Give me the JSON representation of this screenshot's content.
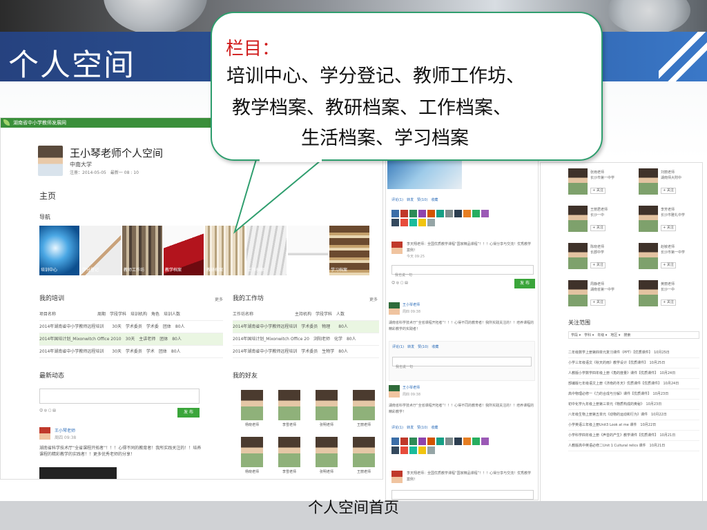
{
  "slide": {
    "title": "个人空间",
    "caption": "个人空间首页"
  },
  "callout": {
    "heading": "栏目：",
    "line1": "培训中心、学分登记、教师工作坊、",
    "line2": "教学档案、教研档案、工作档案、",
    "line3": "生活档案、学习档案"
  },
  "screenshot_left": {
    "site_name": "湖南省中小学教师发展网",
    "profile": {
      "name": "王小琴老师个人空间",
      "org": "中南大学",
      "dates": "注册：2014-05-05　最新一 08 : 10"
    },
    "home_title": "主页",
    "nav_title": "导航",
    "nav_tiles": [
      {
        "label": "培训中心"
      },
      {
        "label": "学分登记"
      },
      {
        "label": "教师工作坊"
      },
      {
        "label": "教学档案"
      },
      {
        "label": "教研档案"
      },
      {
        "label": "工作档案"
      },
      {
        "label": "生活档案"
      },
      {
        "label": "学习档案"
      }
    ],
    "training": {
      "title": "我的培训",
      "more": "更多",
      "rows": [
        "项目名称　　　　　　　　　　周期　学段学科　培训机构　角色　培训人数",
        "2014年湖南省中小学教师远程培训　　30天　学术委员　学术委　团体　80人",
        "2014年国培计划_Mixonwitch Office 2010　30天　主讲老师　团体　80人",
        "2014年湖南省中小学教师远程培训　　30天　学术委员　学术　团体　80人"
      ]
    },
    "workshop": {
      "title": "我的工作坊",
      "more": "更多",
      "rows": [
        "工作坊名称　　　　　　　　　　主持机构　学段学科　人数",
        "2014年湖南省中小学教师远程培训　学术委员　物理　　80人",
        "2014年国培计划_Mixonwitch Office 20　浏阳老师　化学　80人",
        "2014年湖南省中小学教师远程培训　学术委员　生物学　80人"
      ]
    },
    "activity_title": "最新动态",
    "publish_label": "发 布",
    "post_author": "王小琴老师",
    "post_time": "周四 09:38",
    "post_text": "湖南省科学技术厅“全省课程开拓者”！！！心得不同的教育者！我所实践关注的！！培养课程的精彩教学的实践者！！更多优秀老师的分享！",
    "friends_title": "我的好友",
    "friends": [
      "杨晓老师",
      "李雪老师",
      "张明老师",
      "王丽老师",
      "杨晓老师",
      "李雪老师",
      "张明老师",
      "王丽老师"
    ]
  },
  "screenshot_middle": {
    "action_bar": "评论(1)　转发　赞(10)　收藏",
    "comment_text": "李天翔老师：全国优质教学课程“国家精品课程”！！！心得分享与交流！优秀教学案例！",
    "comment_time": "今天 09:25",
    "reply_placeholder": "我也说一句",
    "publish_label": "发 布",
    "post1_author": "王小琴老师",
    "post1_time": "周四 09:38",
    "post1_text": "湖南省科学技术厅“全省课程开拓者”！！！心得不同的教育者！我所实践关注的！！培养课程的精彩教学的实践者！",
    "post2_author": "王小琴老师",
    "post2_time": "周四 09:38",
    "post2_text": "湖南省科学技术厅“全省课程开拓者”！！！心得不同的教育者！我所实践关注的！！培养课程的精彩教学！"
  },
  "screenshot_right": {
    "people": [
      {
        "name": "张雨老师",
        "school": "长沙市第一中学",
        "follow": "+ 关注"
      },
      {
        "name": "刘丽老师",
        "school": "湖南师大附中",
        "follow": "+ 关注"
      },
      {
        "name": "王丽君老师",
        "school": "长沙一中",
        "follow": "+ 关注"
      },
      {
        "name": "李芳老师",
        "school": "长沙市雅礼中学",
        "follow": "+ 关注"
      },
      {
        "name": "陈晓老师",
        "school": "长郡中学",
        "follow": "+ 关注"
      },
      {
        "name": "赵敏老师",
        "school": "长沙市第一中学",
        "follow": "+ 关注"
      },
      {
        "name": "周静老师",
        "school": "湖南省第一中学",
        "follow": "+ 关注"
      },
      {
        "name": "黄丽老师",
        "school": "长沙一中",
        "follow": "+ 关注"
      }
    ],
    "follow_title": "关注范围",
    "filters": "学段 ▾　学科 ▾　年级 ▾　地区 ▾　搜索",
    "rows": [
      "二年级数学上册第四单元复习课件（PPT）【优质课件】　10月25日",
      "小学三年级语文《秋天的雨》教学设计【优质课件】　10月25日",
      "人教版小学数学四年级上册《角的度量》课件【优质课件】　10月24日",
      "部编版七年级语文上册《济南的冬天》优质课件【优质课件】　10月24日",
      "高中物理必修一《力的合成与分解》课件【优质课件】　10月23日",
      "初中化学九年级上册第三单元《物质构成的奥秘》　10月23日",
      "八年级生物上册第五单元《动物的运动和行为》课件　10月22日",
      "小学英语三年级上册Unit3 Look at me 课件　10月22日",
      "小学科学四年级上册《声音的产生》教学课件【优质课件】　10月21日",
      "人教版高中英语必修二Unit 1 Cultural relics 课件　10月21日"
    ]
  }
}
